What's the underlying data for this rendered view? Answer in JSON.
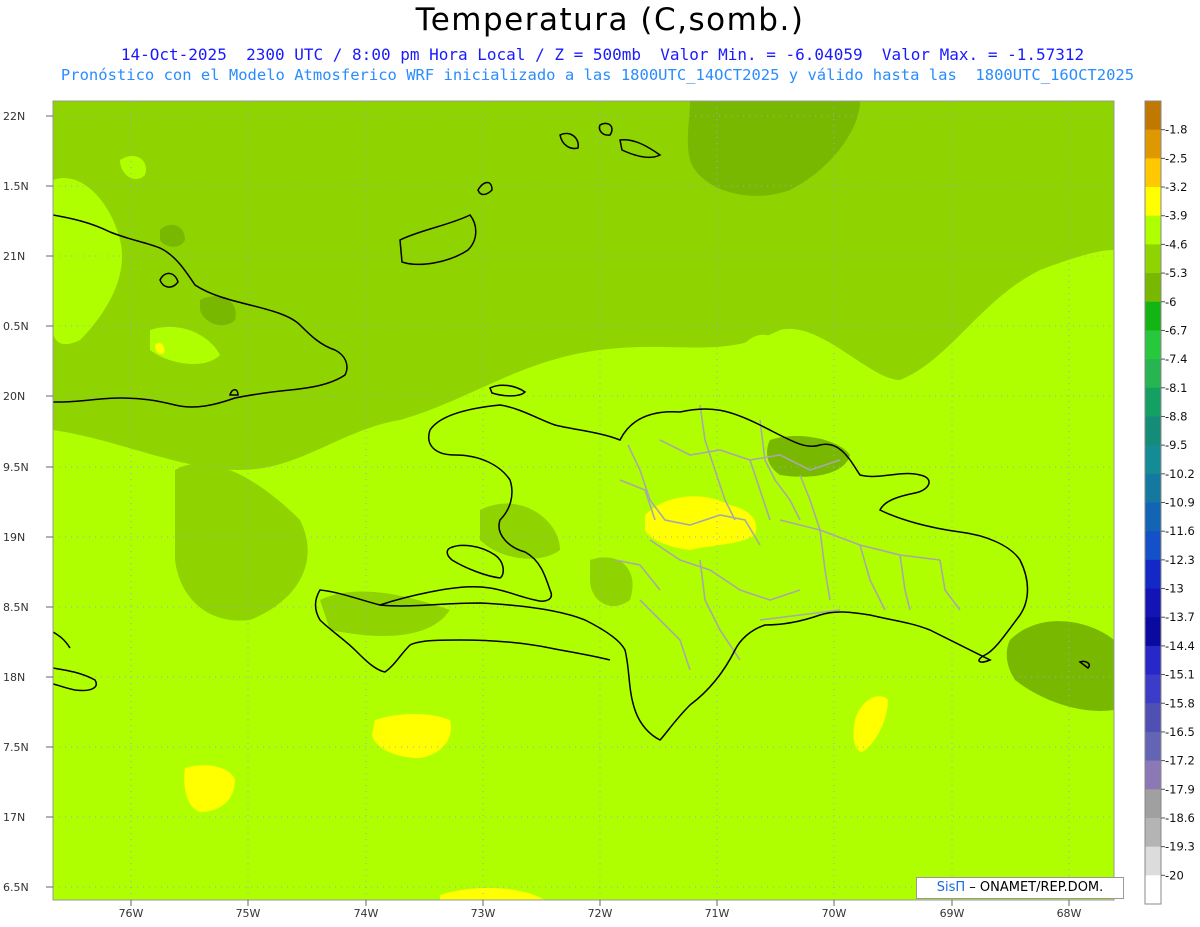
{
  "header": {
    "title": "Temperatura (C,somb.)",
    "subtitle_1": "14-Oct-2025  2300 UTC / 8:00 pm Hora Local / Z = 500mb  Valor Min. = -6.04059  Valor Max. = -1.57312",
    "subtitle_2": "Pronóstico con el Modelo Atmosferico WRF inicializado a las 1800UTC_14OCT2025 y válido hasta las  1800UTC_16OCT2025"
  },
  "map": {
    "lat_labels": [
      "22N",
      "1.5N",
      "21N",
      "0.5N",
      "20N",
      "9.5N",
      "19N",
      "8.5N",
      "18N",
      "7.5N",
      "17N",
      "6.5N"
    ],
    "lon_labels": [
      "76W",
      "75W",
      "74W",
      "73W",
      "72W",
      "71W",
      "70W",
      "69W",
      "68W"
    ],
    "background_color": "#8fd400",
    "colors": {
      "darker_green": "#78b800",
      "mid_green": "#8fd400",
      "light_green": "#b0ff00",
      "yellow": "#ffff00",
      "coast": "#000000",
      "provinces": "#a8a8a8",
      "grid": "#9aa6e6"
    }
  },
  "colorbar": {
    "levels": [
      "-1.8",
      "-2.5",
      "-3.2",
      "-3.9",
      "-4.6",
      "-5.3",
      "-6",
      "-6.7",
      "-7.4",
      "-8.1",
      "-8.8",
      "-9.5",
      "-10.2",
      "-10.9",
      "-11.6",
      "-12.3",
      "-13",
      "-13.7",
      "-14.4",
      "-15.1",
      "-15.8",
      "-16.5",
      "-17.2",
      "-17.9",
      "-18.6",
      "-19.3",
      "-20"
    ],
    "colors": [
      "#c07800",
      "#e09800",
      "#ffc800",
      "#ffff00",
      "#b0ff00",
      "#8fd400",
      "#78b800",
      "#14b414",
      "#28c83c",
      "#28b450",
      "#14a064",
      "#148c78",
      "#148c96",
      "#1478a0",
      "#1464b4",
      "#1450c8",
      "#1428c8",
      "#1414b4",
      "#0a0aa0",
      "#2828c8",
      "#3c3cc8",
      "#5050b4",
      "#6464b4",
      "#8c78b4",
      "#a0a0a0",
      "#b4b4b4",
      "#dcdcdc",
      "#ffffff"
    ]
  },
  "credit": {
    "brand": "SisΠ",
    "text": " – ONAMET/REP.DOM."
  }
}
